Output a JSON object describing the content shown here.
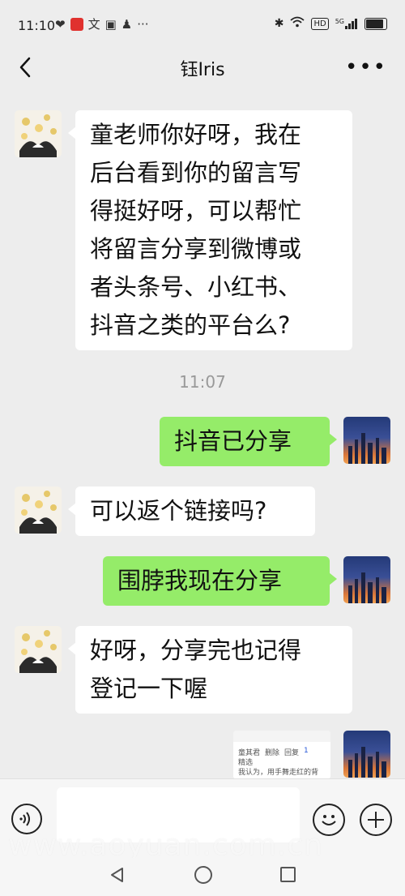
{
  "status_bar": {
    "time": "11:10",
    "left_icons": [
      "heart-icon",
      "red-app-icon",
      "translate-icon",
      "calendar-icon",
      "bell-icon",
      "more-dots-icon"
    ],
    "right_icons": [
      "bluetooth-icon",
      "wifi-icon",
      "hd-badge",
      "5g-signal-icon",
      "battery-icon"
    ],
    "hd_label": "HD",
    "network_label": "5G"
  },
  "header": {
    "title": "钰Iris",
    "back_icon": "chevron-left-icon",
    "more_icon": "more-horizontal-icon"
  },
  "messages": [
    {
      "side": "left",
      "text_lines": [
        "童老师你好呀，我在",
        "后台看到你的留言写",
        "得挺好呀，可以帮忙",
        "将留言分享到微博或",
        "者头条号、小红书、",
        "抖音之类的平台么?"
      ]
    },
    {
      "side": "time",
      "text": "11:07"
    },
    {
      "side": "right",
      "text": "抖音已分享"
    },
    {
      "side": "left",
      "text": "可以返个链接吗?"
    },
    {
      "side": "right",
      "text": "围脖我现在分享"
    },
    {
      "side": "left",
      "text_lines": [
        "好呀，分享完也记得",
        "登记一下喔"
      ]
    }
  ],
  "shared_card": {
    "name": "童其君",
    "actions": [
      "删除",
      "回复"
    ],
    "like_count": "1",
    "status": "精选",
    "snippet": "我认为，用手舞走红的背"
  },
  "input_bar": {
    "voice_icon": "voice-icon",
    "emoji_icon": "emoji-icon",
    "plus_icon": "plus-circle-icon",
    "input_value": ""
  },
  "watermark": "www.aoyuan.com.cn",
  "system_nav": [
    "back-triangle-icon",
    "home-circle-icon",
    "recent-square-icon"
  ],
  "colors": {
    "background": "#ededed",
    "sent_bubble": "#95ec69",
    "received_bubble": "#ffffff"
  }
}
